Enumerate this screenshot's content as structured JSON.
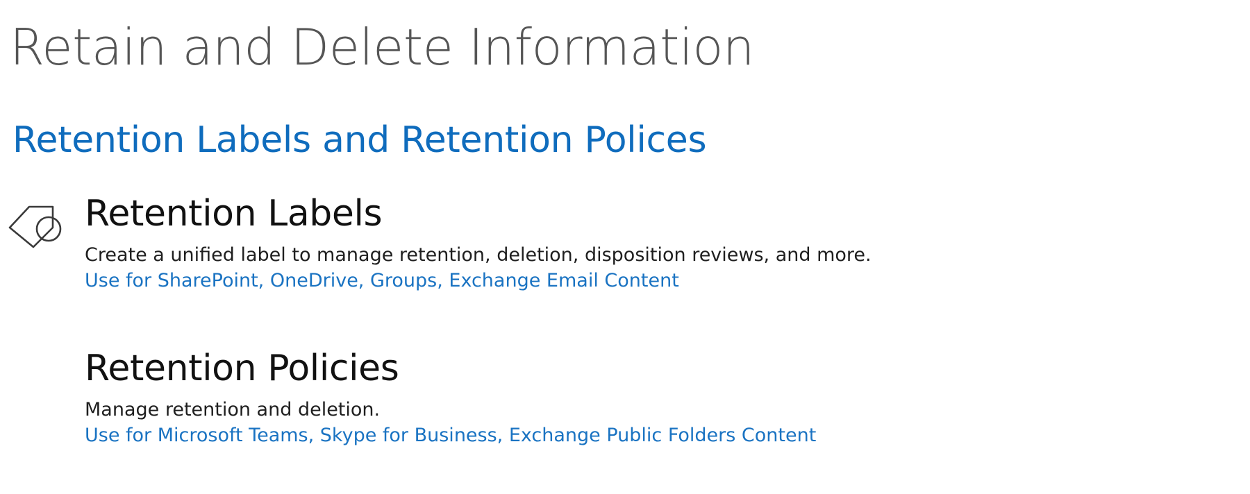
{
  "header": {
    "title": "Retain and Delete Information"
  },
  "section": {
    "title": "Retention Labels and Retention Polices"
  },
  "items": [
    {
      "icon": "retention-label-icon",
      "heading": "Retention Labels",
      "description": "Create a unified label to manage retention, deletion, disposition reviews, and more.",
      "link": "Use for SharePoint, OneDrive, Groups, Exchange Email Content"
    },
    {
      "heading": "Retention Policies",
      "description": "Manage retention and deletion.",
      "link": "Use for Microsoft Teams, Skype for Business, Exchange Public Folders Content"
    }
  ],
  "colors": {
    "accent": "#0f6cbd",
    "link": "#1a73c2",
    "title": "#555555"
  }
}
